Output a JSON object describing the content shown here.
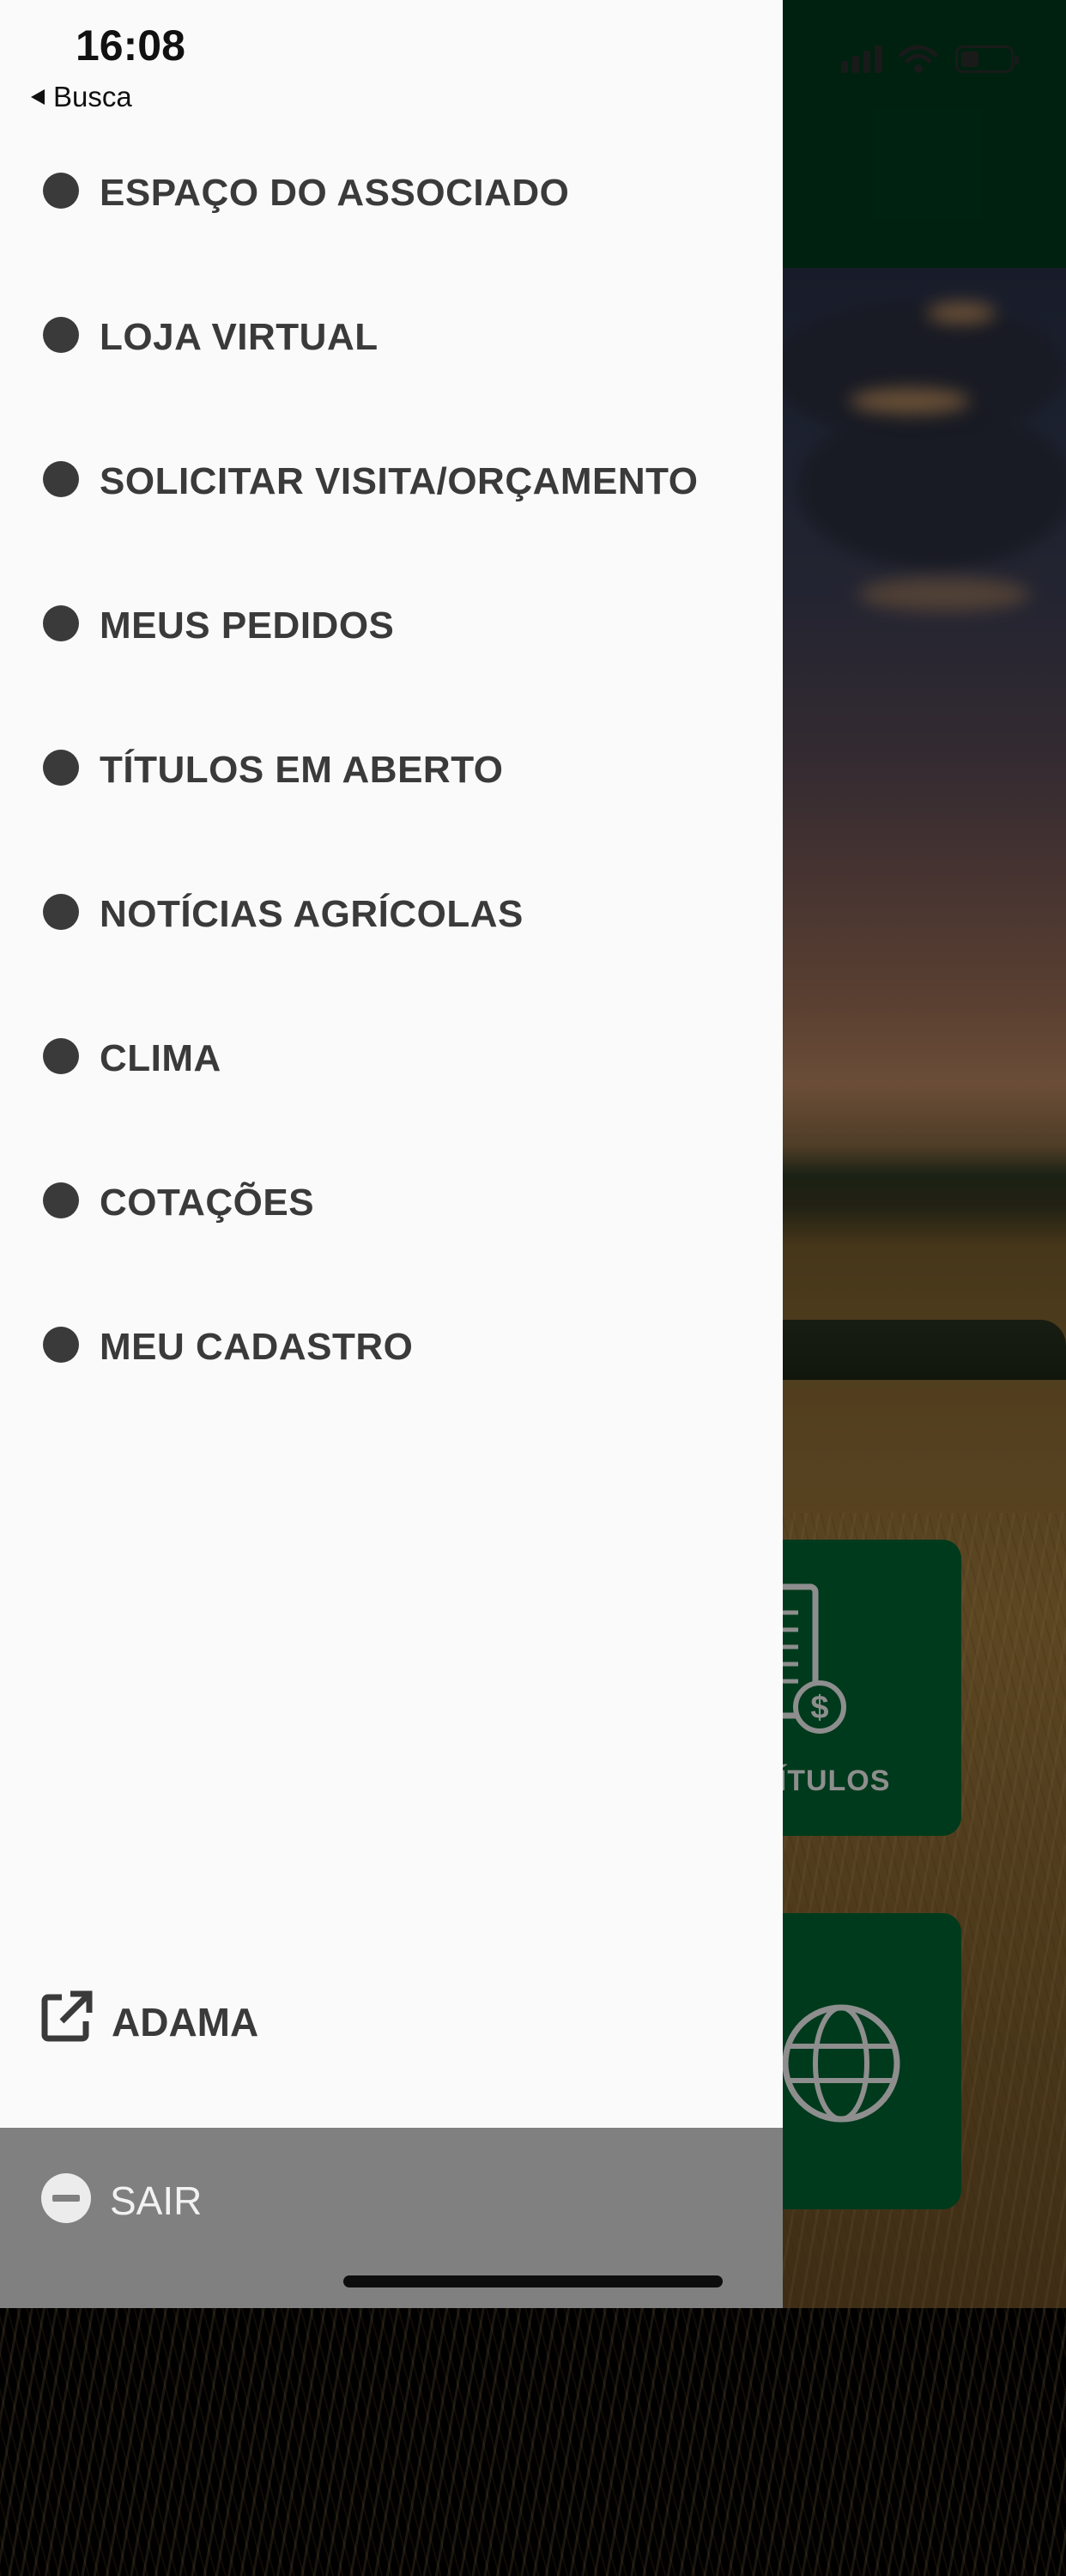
{
  "status_bar": {
    "time": "16:08",
    "back_label": "Busca"
  },
  "drawer": {
    "menu_items": [
      {
        "label": "ESPAÇO DO ASSOCIADO"
      },
      {
        "label": "LOJA VIRTUAL"
      },
      {
        "label": "SOLICITAR VISITA/ORÇAMENTO"
      },
      {
        "label": "MEUS PEDIDOS"
      },
      {
        "label": "TÍTULOS EM ABERTO"
      },
      {
        "label": "NOTÍCIAS AGRÍCOLAS"
      },
      {
        "label": "CLIMA"
      },
      {
        "label": "COTAÇÕES"
      },
      {
        "label": "MEU CADASTRO"
      }
    ],
    "external_link": {
      "label": "ADAMA",
      "icon": "external-link-icon"
    },
    "logout": {
      "label": "SAIR",
      "icon": "minus-circle-icon"
    }
  },
  "background_app": {
    "tiles": [
      {
        "label": "TÍTULOS",
        "icon": "invoice-dollar-icon"
      },
      {
        "label": "",
        "icon": "globe-icon"
      }
    ]
  },
  "colors": {
    "brand_green": "#003a1c",
    "drawer_bg": "#fafafa",
    "menu_text": "#3a3a3a",
    "logout_bar": "#808080"
  }
}
